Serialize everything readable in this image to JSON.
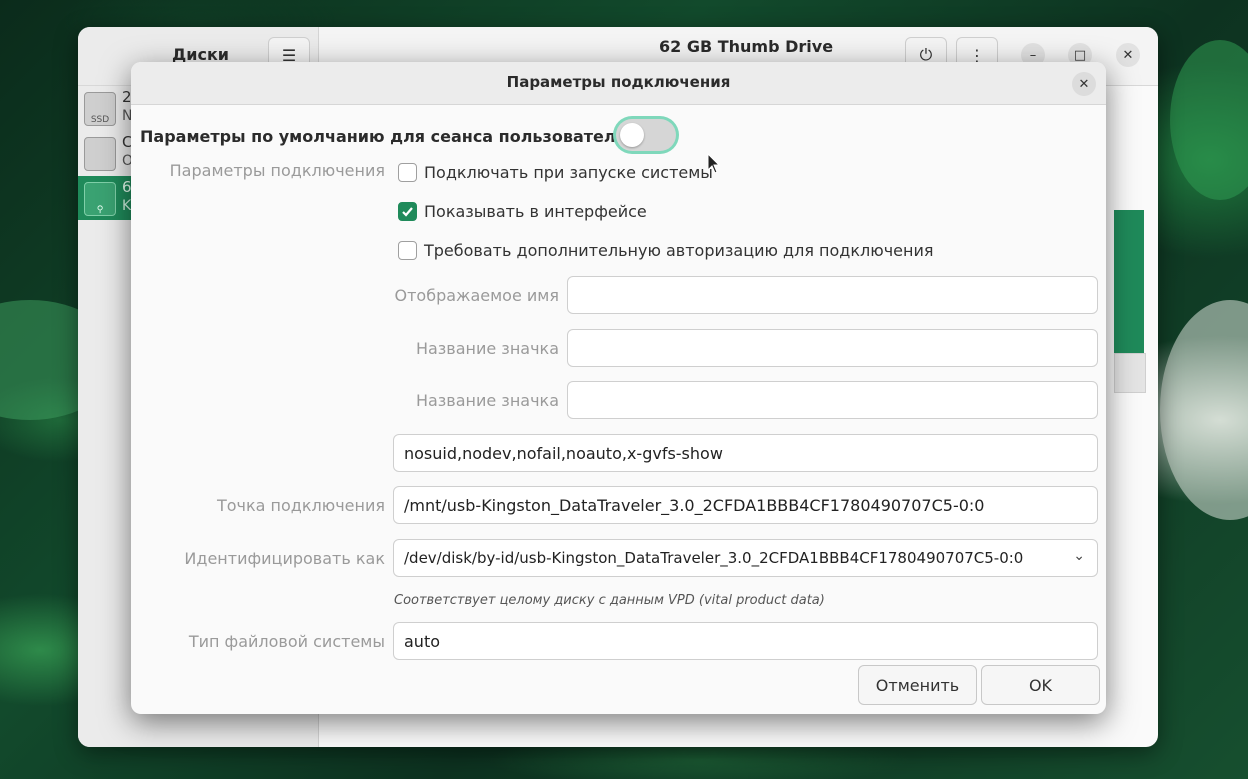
{
  "main_window": {
    "sidebar_title": "Диски",
    "title": "62 GB Thumb Drive",
    "drives": [
      {
        "line1": "2",
        "line2": "N",
        "badge": "SSD"
      },
      {
        "line1": "C",
        "line2": "O",
        "badge": ""
      },
      {
        "line1": "6",
        "line2": "K",
        "badge": ""
      }
    ]
  },
  "dialog": {
    "title": "Параметры подключения",
    "session_defaults_label": "Параметры по умолчанию для сеанса пользователя",
    "session_defaults_on": false,
    "mount_options_label": "Параметры подключения",
    "checkboxes": [
      {
        "label": "Подключать при запуске системы",
        "checked": false
      },
      {
        "label": "Показывать в интерфейсе",
        "checked": true
      },
      {
        "label": "Требовать дополнительную авторизацию для подключения",
        "checked": false
      }
    ],
    "display_name_label": "Отображаемое имя",
    "display_name_value": "",
    "icon_name_label": "Название значка",
    "icon_name_value": "",
    "icon_name2_label": "Название значка",
    "icon_name2_value": "",
    "options_value": "nosuid,nodev,nofail,noauto,x-gvfs-show",
    "mount_point_label": "Точка подключения",
    "mount_point_value": "/mnt/usb-Kingston_DataTraveler_3.0_2CFDA1BBB4CF1780490707C5-0:0",
    "identify_as_label": "Идентифицировать как",
    "identify_as_value": "/dev/disk/by-id/usb-Kingston_DataTraveler_3.0_2CFDA1BBB4CF1780490707C5-0:0",
    "identify_hint": "Соответствует целому диску с данным VPD (vital product data)",
    "fs_type_label": "Тип файловой системы",
    "fs_type_value": "auto",
    "cancel_label": "Отменить",
    "ok_label": "OK"
  },
  "colors": {
    "accent": "#1f8a5a",
    "toggle_focus": "#7fd8bb"
  }
}
